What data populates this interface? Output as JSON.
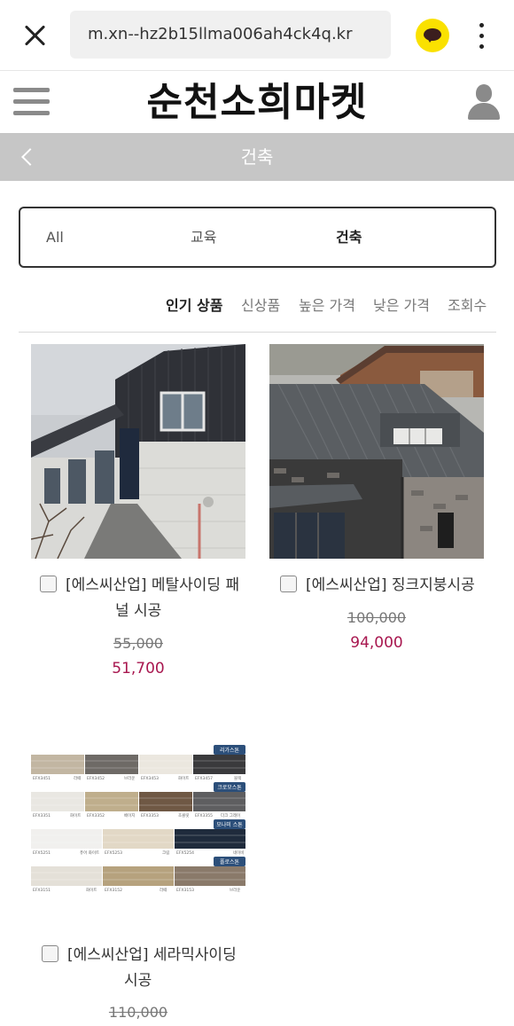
{
  "browser": {
    "url": "m.xn--hz2b15llma006ah4ck4q.kr",
    "kakao_color": "#FAE100"
  },
  "site": {
    "logo": "순천소희마켓",
    "accent_price_color": "#a8174f"
  },
  "category": {
    "title": "건축"
  },
  "tabs": [
    {
      "label": "All",
      "active": false
    },
    {
      "label": "교육",
      "active": false
    },
    {
      "label": "건축",
      "active": true
    }
  ],
  "sort": [
    {
      "label": "인기 상품",
      "active": true
    },
    {
      "label": "신상품",
      "active": false
    },
    {
      "label": "높은 가격",
      "active": false
    },
    {
      "label": "낮은 가격",
      "active": false
    },
    {
      "label": "조회수",
      "active": false
    }
  ],
  "products": [
    {
      "name_line1": "[에스씨산업] 메탈사이딩 패",
      "name_line2": "널 시공",
      "old_price": "55,000",
      "new_price": "51,700"
    },
    {
      "name_line1": "[에스씨산업] 징크지붕시공",
      "name_line2": "",
      "old_price": "100,000",
      "new_price": "94,000"
    },
    {
      "name_line1": "[에스씨산업] 세라믹사이딩",
      "name_line2": "시공",
      "old_price": "110,000",
      "new_price": ""
    }
  ],
  "swatch_sheet": {
    "badges": [
      "리가스톤",
      "크로모스톤",
      "모나미 스톤",
      "폴로스톤"
    ],
    "rows": [
      [
        "EFX3451",
        "라떼",
        "EFX3452",
        "브라운",
        "EFX3453",
        "화이트",
        "EFX3457",
        "블랙"
      ],
      [
        "EFX3351",
        "화이트",
        "EFX3352",
        "베이지",
        "EFX3353",
        "초콜릿",
        "EFX3355",
        "다크 그레이"
      ],
      [
        "EFX5251",
        "퓨어 화이트",
        "EFX5253",
        "크림",
        "EFX5254",
        "네이비"
      ],
      [
        "EFX3151",
        "화이트",
        "EFX3152",
        "라떼",
        "EFX3153",
        "브라운"
      ]
    ]
  }
}
